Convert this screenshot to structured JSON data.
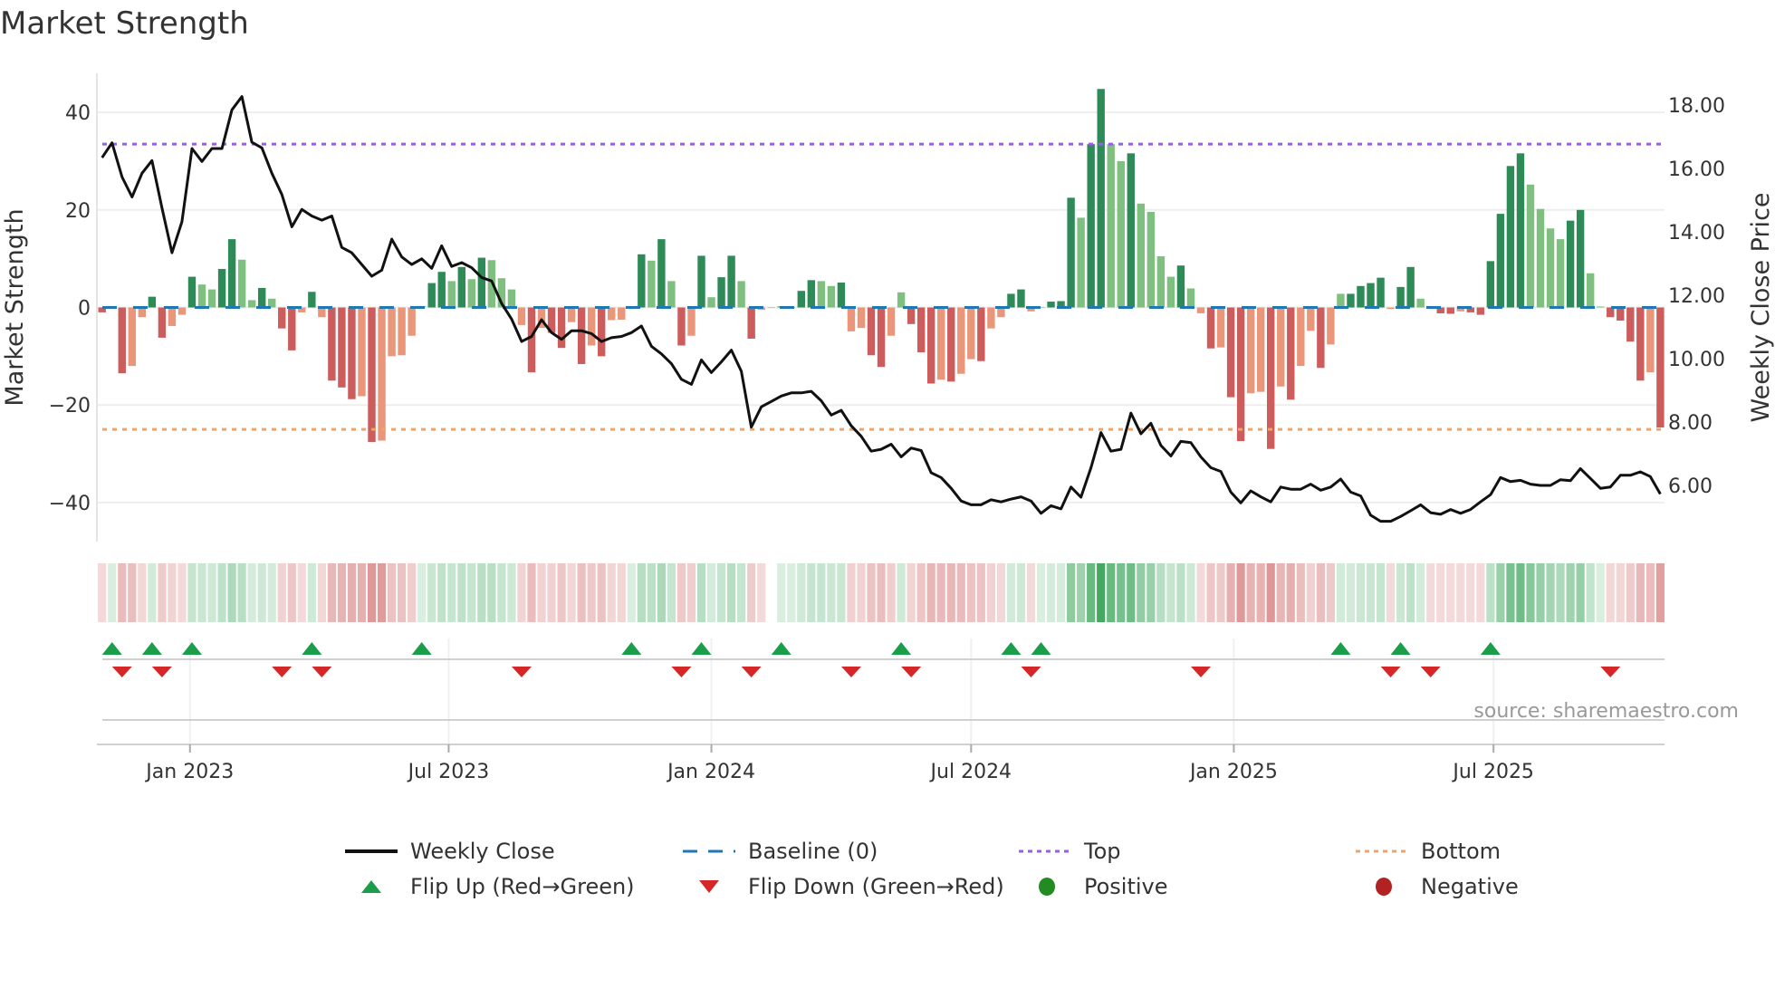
{
  "title": "Market Strength",
  "source": "source: sharemaestro.com",
  "colors": {
    "pos_strong": "#2e8b57",
    "pos_weak": "#7fbf7f",
    "neg_strong": "#cd5c5c",
    "neg_weak": "#e9967a",
    "price": "#111111",
    "baseline": "#1f77b4",
    "top": "#9b5de5",
    "bottom": "#f4a261",
    "flip_up": "#1a9e4a",
    "flip_down": "#d62728",
    "positive": "#228b22",
    "negative": "#b22222"
  },
  "legend": [
    {
      "label": "Weekly Close",
      "icon": "line-solid"
    },
    {
      "label": "Baseline (0)",
      "icon": "line-dashed"
    },
    {
      "label": "Top",
      "icon": "line-dotted-purple"
    },
    {
      "label": "Bottom",
      "icon": "line-dotted-orange"
    },
    {
      "label": "Flip Up (Red→Green)",
      "icon": "triangle-up"
    },
    {
      "label": "Flip Down (Green→Red)",
      "icon": "triangle-down"
    },
    {
      "label": "Positive",
      "icon": "circle-green"
    },
    {
      "label": "Negative",
      "icon": "circle-red"
    }
  ],
  "chart_data": {
    "type": "bar",
    "title": "Market Strength",
    "ylabel": "Market Strength",
    "y2label": "Weekly Close Price",
    "ylim": [
      -48,
      48
    ],
    "y2lim": [
      4.23,
      19
    ],
    "yticks": [
      {
        "v": 40,
        "label": "40"
      },
      {
        "v": 20,
        "label": "20"
      },
      {
        "v": 0,
        "label": "0"
      },
      {
        "v": -20,
        "label": "−20"
      },
      {
        "v": -40,
        "label": "−40"
      }
    ],
    "y2ticks": [
      {
        "v": 18,
        "label": "18.00"
      },
      {
        "v": 16,
        "label": "16.00"
      },
      {
        "v": 14,
        "label": "14.00"
      },
      {
        "v": 12,
        "label": "12.00"
      },
      {
        "v": 10,
        "label": "10.00"
      },
      {
        "v": 8,
        "label": "8.00"
      },
      {
        "v": 6,
        "label": "6.00"
      }
    ],
    "xticks": [
      {
        "week": 8.8,
        "label": "Jan 2023"
      },
      {
        "week": 34.7,
        "label": "Jul 2023"
      },
      {
        "week": 61,
        "label": "Jan 2024"
      },
      {
        "week": 87,
        "label": "Jul 2024"
      },
      {
        "week": 113.3,
        "label": "Jan 2025"
      },
      {
        "week": 139.3,
        "label": "Jul 2025"
      }
    ],
    "top_level": 33.5,
    "bottom_level": -25,
    "baseline": 0,
    "strength": [
      -1,
      0.1,
      -13.5,
      -12,
      -2,
      2.2,
      -6.2,
      -3.8,
      -1.5,
      6.3,
      4.7,
      3.7,
      7.9,
      14,
      9.8,
      1.5,
      4,
      1.8,
      -4.3,
      -8.8,
      -1,
      3.2,
      -2,
      -15,
      -16.4,
      -18.8,
      -18.2,
      -27.6,
      -27.3,
      -10,
      -9.8,
      -5.8,
      0.3,
      5,
      7.3,
      5.4,
      8.3,
      5.8,
      10.2,
      9.7,
      6,
      3.7,
      -3.6,
      -13.3,
      -4.2,
      -5.2,
      -8.3,
      -3,
      -11.6,
      -7.8,
      -10,
      -2.6,
      -2.5,
      0.2,
      10.9,
      9.6,
      14,
      5.4,
      -7.8,
      -5.8,
      10.6,
      2.1,
      6.2,
      10.6,
      5.4,
      -6.4,
      -0.5,
      0,
      0.2,
      0.1,
      3.4,
      5.6,
      5.4,
      4.4,
      5.1,
      -4.9,
      -4.2,
      -9.8,
      -12.2,
      -5.8,
      3.1,
      -3.4,
      -9.2,
      -15.6,
      -14.8,
      -15.2,
      -13.6,
      -10.6,
      -11,
      -4.3,
      -2,
      2.8,
      3.7,
      -0.8,
      0.1,
      1.2,
      1.3,
      22.5,
      18.4,
      33.5,
      44.8,
      33.5,
      30,
      31.6,
      21.3,
      19.6,
      10.5,
      6.3,
      8.6,
      3.9,
      -1.2,
      -8.4,
      -8.2,
      -18.4,
      -27.4,
      -17.6,
      -17.3,
      -29,
      -16.2,
      -18.9,
      -12,
      -4.8,
      -12.4,
      -7.6,
      2.8,
      2.8,
      4.4,
      5,
      6.1,
      -0.3,
      4.2,
      8.3,
      1.8,
      -0.2,
      -1.2,
      -1.3,
      -0.8,
      -1,
      -1.5,
      9.5,
      19.2,
      29,
      31.6,
      25.2,
      20.2,
      16.2,
      14,
      17.8,
      20,
      7,
      0.2,
      -2,
      -2.7,
      -7,
      -15,
      -13.3,
      -24.6
    ],
    "weekly_close": [
      16.34,
      16.81,
      15.73,
      15.1,
      15.85,
      16.25,
      14.75,
      13.34,
      14.32,
      16.63,
      16.22,
      16.63,
      16.63,
      17.85,
      18.27,
      16.83,
      16.65,
      15.85,
      15.18,
      14.16,
      14.71,
      14.5,
      14.37,
      14.5,
      13.51,
      13.34,
      12.97,
      12.6,
      12.79,
      13.77,
      13.21,
      12.97,
      13.15,
      12.85,
      13.56,
      12.91,
      13.03,
      12.87,
      12.56,
      12.45,
      11.74,
      11.25,
      10.54,
      10.7,
      11.23,
      10.82,
      10.61,
      10.88,
      10.88,
      10.79,
      10.54,
      10.66,
      10.7,
      10.82,
      11.03,
      10.39,
      10.15,
      9.84,
      9.35,
      9.19,
      9.96,
      9.56,
      9.9,
      10.27,
      9.6,
      7.84,
      8.48,
      8.65,
      8.82,
      8.92,
      8.92,
      8.97,
      8.67,
      8.22,
      8.37,
      7.88,
      7.55,
      7.08,
      7.14,
      7.3,
      6.9,
      7.18,
      7.1,
      6.4,
      6.25,
      5.91,
      5.51,
      5.39,
      5.39,
      5.55,
      5.48,
      5.57,
      5.64,
      5.51,
      5.12,
      5.36,
      5.26,
      5.95,
      5.63,
      6.56,
      7.67,
      7.08,
      7.14,
      8.28,
      7.63,
      7.96,
      7.26,
      6.93,
      7.39,
      7.35,
      6.9,
      6.56,
      6.44,
      5.79,
      5.45,
      5.83,
      5.64,
      5.48,
      5.95,
      5.88,
      5.88,
      6.04,
      5.85,
      5.95,
      6.2,
      5.79,
      5.67,
      5.06,
      4.87,
      4.87,
      5.02,
      5.2,
      5.39,
      5.14,
      5.09,
      5.24,
      5.12,
      5.24,
      5.48,
      5.71,
      6.25,
      6.12,
      6.16,
      6.04,
      6.0,
      6.0,
      6.18,
      6.15,
      6.53,
      6.22,
      5.91,
      5.95,
      6.32,
      6.32,
      6.43,
      6.28,
      5.73
    ],
    "flip_up_weeks": [
      1,
      5,
      9,
      21,
      32,
      53,
      60,
      68,
      80,
      91,
      94,
      124,
      130,
      139
    ],
    "flip_down_weeks": [
      2,
      6,
      18,
      22,
      42,
      58,
      65,
      75,
      81,
      93,
      110,
      129,
      133,
      151
    ],
    "legend_placement": "bottom"
  }
}
